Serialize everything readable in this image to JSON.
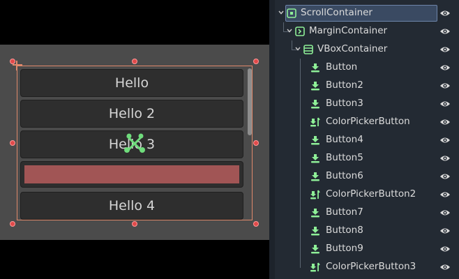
{
  "viewport": {
    "buttons": [
      "Hello",
      "Hello 2",
      "Hello 3",
      "Hello 4"
    ],
    "picker_color": "#a15555"
  },
  "scene_tree": [
    {
      "name": "ScrollContainer",
      "icon": "scroll-container-icon",
      "selected": true,
      "arrow": true
    },
    {
      "name": "MarginContainer",
      "icon": "margin-container-icon",
      "arrow": true
    },
    {
      "name": "VBoxContainer",
      "icon": "vbox-container-icon",
      "arrow": true
    },
    {
      "name": "Button",
      "icon": "button-icon"
    },
    {
      "name": "Button2",
      "icon": "button-icon"
    },
    {
      "name": "Button3",
      "icon": "button-icon"
    },
    {
      "name": "ColorPickerButton",
      "icon": "color-picker-button-icon"
    },
    {
      "name": "Button4",
      "icon": "button-icon"
    },
    {
      "name": "Button5",
      "icon": "button-icon"
    },
    {
      "name": "Button6",
      "icon": "button-icon"
    },
    {
      "name": "ColorPickerButton2",
      "icon": "color-picker-button-icon"
    },
    {
      "name": "Button7",
      "icon": "button-icon"
    },
    {
      "name": "Button8",
      "icon": "button-icon"
    },
    {
      "name": "Button9",
      "icon": "button-icon"
    },
    {
      "name": "ColorPickerButton3",
      "icon": "color-picker-button-icon"
    }
  ],
  "colors": {
    "selection_border": "#e0896b",
    "node_icon_green": "#8eef97"
  }
}
